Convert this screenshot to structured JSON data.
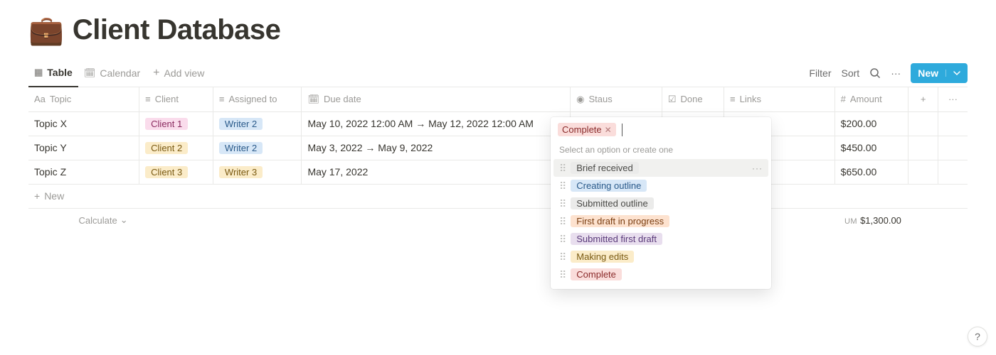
{
  "header": {
    "icon": "💼",
    "title": "Client Database"
  },
  "views": {
    "tabs": [
      {
        "name": "table",
        "label": "Table",
        "active": true
      },
      {
        "name": "calendar",
        "label": "Calendar",
        "active": false
      }
    ],
    "add_view_label": "Add view"
  },
  "toolbar": {
    "filter_label": "Filter",
    "sort_label": "Sort",
    "new_label": "New"
  },
  "columns": {
    "topic": "Topic",
    "client": "Client",
    "assigned": "Assigned to",
    "due": "Due date",
    "status": "Staus",
    "done": "Done",
    "links": "Links",
    "amount": "Amount"
  },
  "rows": [
    {
      "topic": "Topic X",
      "client": {
        "label": "Client 1",
        "color": "pink"
      },
      "assigned": {
        "label": "Writer 2",
        "color": "blue"
      },
      "due": "May 10, 2022 12:00 AM → May 12, 2022 12:00 AM",
      "status": {
        "label": "Complete",
        "color": "red"
      },
      "amount": "$200.00"
    },
    {
      "topic": "Topic Y",
      "client": {
        "label": "Client 2",
        "color": "yellow"
      },
      "assigned": {
        "label": "Writer 2",
        "color": "blue"
      },
      "due": "May 3, 2022 → May 9, 2022",
      "status": null,
      "amount": "$450.00"
    },
    {
      "topic": "Topic Z",
      "client": {
        "label": "Client 3",
        "color": "yellow"
      },
      "assigned": {
        "label": "Writer 3",
        "color": "yellow"
      },
      "due": "May 17, 2022",
      "status": null,
      "amount": "$650.00"
    }
  ],
  "new_row_label": "New",
  "calculate": {
    "label": "Calculate",
    "sum_prefix": "UM",
    "sum_value": "$1,300.00"
  },
  "status_popover": {
    "selected": {
      "label": "Complete"
    },
    "search_placeholder": "Select an option or create one",
    "options": [
      {
        "label": "Brief received",
        "color": "gray",
        "highlight": true
      },
      {
        "label": "Creating outline",
        "color": "blue"
      },
      {
        "label": "Submitted outline",
        "color": "gray"
      },
      {
        "label": "First draft in progress",
        "color": "orange"
      },
      {
        "label": "Submitted first draft",
        "color": "purple"
      },
      {
        "label": "Making edits",
        "color": "yellow"
      },
      {
        "label": "Complete",
        "color": "red"
      }
    ]
  },
  "help_label": "?"
}
